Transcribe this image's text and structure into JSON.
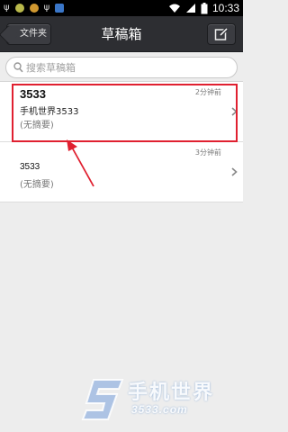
{
  "statusbar": {
    "time": "10:33"
  },
  "header": {
    "back_label": "文件夹",
    "title": "草稿箱"
  },
  "search": {
    "placeholder": "搜索草稿箱"
  },
  "drafts": [
    {
      "name": "3533",
      "subject": "手机世界3533",
      "summary": "(无摘要)",
      "time": "2分钟前"
    },
    {
      "name": "3533",
      "subject": "",
      "summary": "(无摘要)",
      "time": "3分钟前"
    }
  ],
  "colors": {
    "highlight": "#e02030",
    "titlebar": "#2d2e32"
  },
  "watermark": {
    "title": "手机世界",
    "subtitle": "3533.com"
  }
}
